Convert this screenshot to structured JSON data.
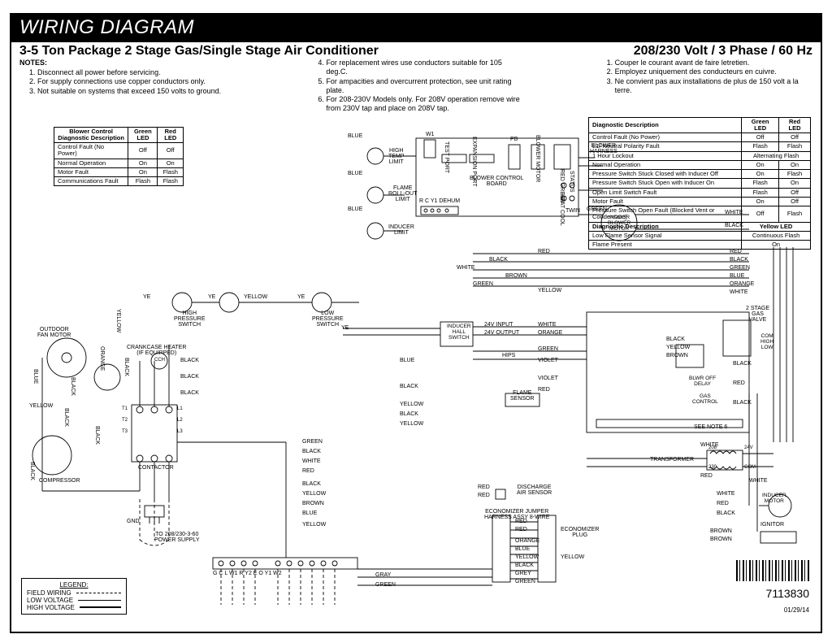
{
  "title": "WIRING DIAGRAM",
  "subtitle_left": "3-5 Ton Package 2 Stage Gas/Single Stage Air Conditioner",
  "subtitle_right": "208/230 Volt / 3 Phase / 60 Hz",
  "notes_label": "NOTES:",
  "notes_col1": [
    "Disconnect all power before servicing.",
    "For supply connections use copper conductors only.",
    "Not suitable on systems that exceed 150 volts to ground."
  ],
  "notes_col2": [
    "For replacement wires use conductors suitable for 105 deg.C.",
    "For ampacities and overcurrent protection, see unit rating plate.",
    "For 208-230V Models only.  For 208V operation remove wire from 230V tap and place on 208V tap."
  ],
  "notes_col3": [
    "Couper le courant avant de faire letretien.",
    "Employez uniquement des conducteurs en cuivre.",
    "Ne convient pas aux installations de plus de 150 volt a la terre."
  ],
  "blower_table": {
    "header": [
      "Blower Control Diagnostic Description",
      "Green LED",
      "Red LED"
    ],
    "rows": [
      [
        "Control Fault (No Power)",
        "Off",
        "Off"
      ],
      [
        "Normal Operation",
        "On",
        "On"
      ],
      [
        "Motor Fault",
        "On",
        "Flash"
      ],
      [
        "Communications Fault",
        "Flash",
        "Flash"
      ]
    ]
  },
  "diag_table": {
    "header": [
      "Diagnostic Description",
      "Green LED",
      "Red LED"
    ],
    "rows": [
      [
        "Control Fault (No Power)",
        "Off",
        "Off"
      ],
      [
        "L1/ Neutral Polarity Fault",
        "Flash",
        "Flash"
      ],
      [
        "1 Hour Lockout",
        {
          "span": 2,
          "text": "Alternating Flash"
        }
      ],
      [
        "Normal Operation",
        "On",
        "On"
      ],
      [
        "Pressure Switch Stuck Closed with Inducer Off",
        "On",
        "Flash"
      ],
      [
        "Pressure Switch Stuck Open with Inducer On",
        "Flash",
        "On"
      ],
      [
        "Open Limit Switch Fault",
        "Flash",
        "Off"
      ],
      [
        "Motor Fault",
        "On",
        "Off"
      ],
      [
        "Pressure Switch Open Fault (Blocked Vent or Condensate)",
        "Off",
        "Flash"
      ]
    ],
    "header2": [
      "Diagnostic Description",
      {
        "span": 2,
        "text": "Yellow LED"
      }
    ],
    "rows2": [
      [
        "Low Flame Sensor Signal",
        {
          "span": 2,
          "text": "Continuous Flash"
        }
      ],
      [
        "Flame Present",
        {
          "span": 2,
          "text": "On"
        }
      ]
    ]
  },
  "legend": {
    "title": "LEGEND:",
    "field": "FIELD WIRING",
    "low": "LOW VOLTAGE",
    "high": "HIGH VOLTAGE"
  },
  "components": {
    "w1": "W1",
    "high_temp_limit": "HIGH\nTEMP\nLIMIT",
    "flame_rollout": "FLAME\nROLL-OUT\nLIMIT",
    "inducer_limit": "INDUCER\nLIMIT",
    "blower_ctrl_board": "BLOWER CONTROL\nBOARD",
    "test_port": "TEST PORT",
    "expansion_port": "EXPANSION\nPORT",
    "pb": "PB",
    "blower_motor": "BLOWER MOTOR",
    "status": "STATUS",
    "red_green": "RED   GREEN",
    "heat_cool": "HEAT   COOL",
    "r_c_y1_dehum": "R   C   Y1   DEHUM",
    "twin": "TWIN",
    "blower_harness": "BLOWER\nHARNESS",
    "indoor_blower_motor": "INDOOR\nBLOWER\nMOTOR",
    "hps_label": "HIGH\nPRESSURE\nSWITCH",
    "lps_label": "LOW\nPRESSURE\nSWITCH",
    "inducer_hall_switch": "INDUCER\nHALL\nSWITCH",
    "input_24v": "24V INPUT",
    "output_24v": "24V OUTPUT",
    "hips": "HIPS",
    "flame_sensor": "FLAME\nSENSOR",
    "blwr_off_delay": "BLWR OFF\nDELAY",
    "gas_control": "GAS\nCONTROL",
    "two_stage_gas_valve": "2 STAGE\nGAS\nVALVE",
    "com_high_low": "COM\nHIGH\nLOW",
    "xfmr": "TRANSFORMER",
    "tap208": "208",
    "tap230": "230",
    "tap24v": "24V",
    "tapcom": "COM",
    "see_note6": "SEE NOTE 6",
    "discharge_air_sensor": "DISCHARGE\nAIR SENSOR",
    "econ_jumper": "ECONOMIZER JUMPER\nHARNESS ASSY 8-WIRE",
    "econ_plug": "ECONOMIZER\nPLUG",
    "inducer_motor": "INDUCER\nMOTOR",
    "ignitor": "IGNITOR",
    "outdoor_fan_motor": "OUTDOOR\nFAN MOTOR",
    "compressor": "COMPRESSOR",
    "contactor": "CONTACTOR",
    "crankcase": "CRANKCASE HEATER\n(IF EQUIPPED)",
    "cch": "CCH",
    "to_supply": "TO 208/230-3-60\nPOWER SUPPLY",
    "gnd": "GND",
    "terminals": "G   C   L   W1      R   Y2   E   O   Y1   W2"
  },
  "wire_colors": {
    "blue": "BLUE",
    "black": "BLACK",
    "white": "WHITE",
    "red": "RED",
    "green": "GREEN",
    "yellow": "YELLOW",
    "orange": "ORANGE",
    "brown": "BROWN",
    "violet": "VIOLET",
    "gray": "GRAY",
    "grey": "GREY",
    "ye": "YE"
  },
  "contactor_terms": {
    "l1": "L1",
    "l2": "L2",
    "l3": "L3",
    "t1": "T1",
    "t2": "T2",
    "t3": "T3"
  },
  "doc": {
    "number": "7113830",
    "date": "01/29/14"
  }
}
